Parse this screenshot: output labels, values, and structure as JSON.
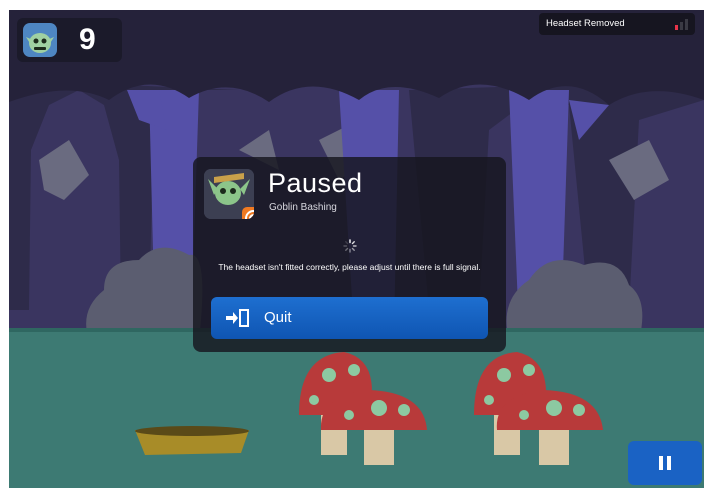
{
  "hud": {
    "score": "9"
  },
  "status": {
    "headset_text": "Headset Removed",
    "signal_color": "#e8344a"
  },
  "pause_modal": {
    "title": "Paused",
    "game_name": "Goblin Bashing",
    "message": "The headset isn't fitted correctly, please adjust until there is full signal.",
    "quit_label": "Quit",
    "quit_icon": "exit-door-icon"
  },
  "pause_button": {
    "icon": "pause-icon"
  },
  "colors": {
    "accent_blue": "#1a62c4",
    "badge_orange": "#f07a22",
    "ground": "#3d7a73",
    "sky": "#2b2840"
  }
}
